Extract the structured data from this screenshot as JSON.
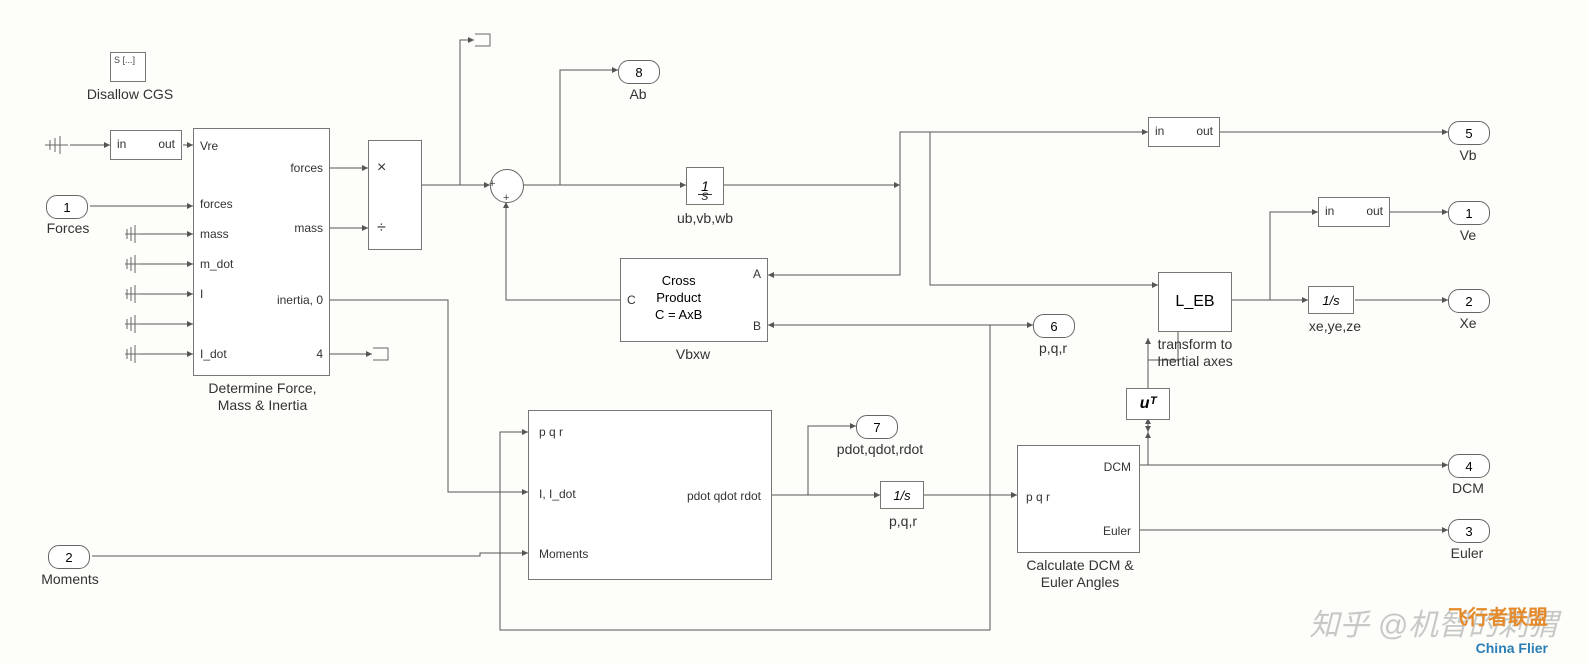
{
  "disallow_cgs": {
    "label": "Disallow CGS"
  },
  "selector1": {
    "in": "in",
    "out": "out"
  },
  "inports": {
    "forces": {
      "num": "1",
      "label": "Forces"
    },
    "moments": {
      "num": "2",
      "label": "Moments"
    }
  },
  "determine_block": {
    "label": "Determine Force,\nMass & Inertia",
    "left_ports": [
      "Vre",
      "forces",
      "mass",
      "m_dot",
      "I",
      "I_dot"
    ],
    "right_ports": [
      "forces",
      "mass",
      "inertia, 0",
      "4"
    ]
  },
  "divide_block": {
    "top": "×",
    "bot": "÷"
  },
  "integrator1": {
    "text": "1/s",
    "label": "ub,vb,wb"
  },
  "cross_block": {
    "line1": "Cross",
    "line2": "Product",
    "line3": "C = AxB",
    "A": "A",
    "B": "B",
    "C": "C",
    "label": "Vbxw"
  },
  "selector2": {
    "in": "in",
    "out": "out"
  },
  "selector3": {
    "in": "in",
    "out": "out"
  },
  "leb_block": {
    "text": "L_EB",
    "label": "transform to\nInertial axes"
  },
  "integrator2": {
    "text": "1/s",
    "label": "xe,ye,ze"
  },
  "transpose": {
    "text": "uᵀ"
  },
  "rates_block": {
    "left": [
      "p q r",
      "I, I_dot",
      "Moments"
    ],
    "out": "pdot qdot rdot"
  },
  "integrator3": {
    "text": "1/s",
    "label": "p,q,r"
  },
  "dcm_block": {
    "left": "p q r",
    "right": [
      "DCM",
      "Euler"
    ],
    "label": "Calculate DCM &\nEuler Angles"
  },
  "outports": {
    "ab": {
      "num": "8",
      "label": "Ab"
    },
    "vb": {
      "num": "5",
      "label": "Vb"
    },
    "ve": {
      "num": "1",
      "label": "Ve"
    },
    "xe": {
      "num": "2",
      "label": "Xe"
    },
    "pqr": {
      "num": "6",
      "label": "p,q,r"
    },
    "pdot": {
      "num": "7",
      "label": "pdot,qdot,rdot"
    },
    "dcm": {
      "num": "4",
      "label": "DCM"
    },
    "euler": {
      "num": "3",
      "label": "Euler"
    }
  },
  "watermark": "知乎 @机智的刺猬",
  "watermark2": "飞行者联盟",
  "watermark3": "China Flier"
}
